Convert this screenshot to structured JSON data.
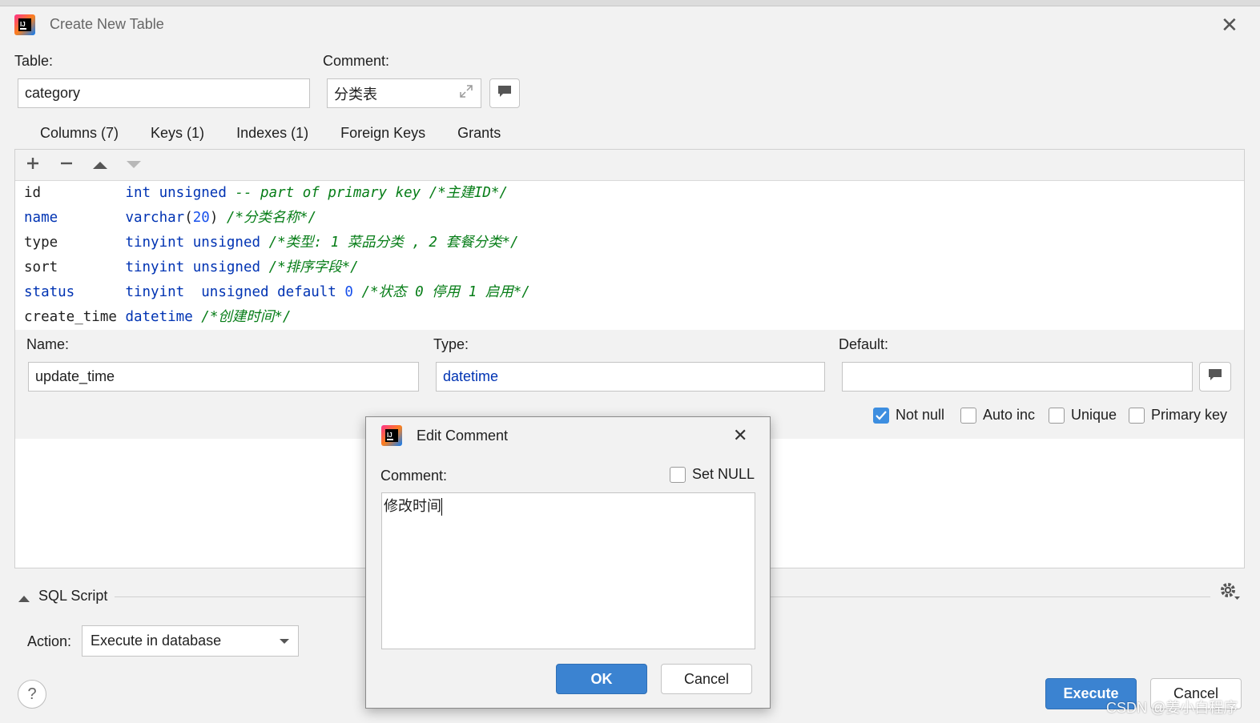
{
  "window": {
    "title": "Create New Table"
  },
  "table": {
    "label": "Table:",
    "value": "category"
  },
  "comment": {
    "label": "Comment:",
    "value": "分类表"
  },
  "tabs": [
    {
      "label": "Columns (7)"
    },
    {
      "label": "Keys (1)"
    },
    {
      "label": "Indexes (1)"
    },
    {
      "label": "Foreign Keys"
    },
    {
      "label": "Grants"
    }
  ],
  "columns": [
    {
      "name": "id",
      "def": "int unsigned -- part of primary key /*主建ID*/"
    },
    {
      "name": "name",
      "def": "varchar(20) /*分类名称*/"
    },
    {
      "name": "type",
      "def": "tinyint unsigned /*类型: 1 菜品分类 , 2 套餐分类*/"
    },
    {
      "name": "sort",
      "def": "tinyint unsigned /*排序字段*/"
    },
    {
      "name": "status",
      "def": "tinyint  unsigned default 0 /*状态 0 停用 1 启用*/"
    },
    {
      "name": "create_time",
      "def": "datetime /*创建时间*/"
    }
  ],
  "props": {
    "name_label": "Name:",
    "name_value": "update_time",
    "type_label": "Type:",
    "type_value": "datetime",
    "default_label": "Default:",
    "default_value": "",
    "not_null": "Not null",
    "auto_inc": "Auto inc",
    "unique": "Unique",
    "primary_key": "Primary key"
  },
  "sql_script": {
    "label": "SQL Script"
  },
  "action": {
    "label": "Action:",
    "value": "Execute in database"
  },
  "buttons": {
    "execute": "Execute",
    "cancel": "Cancel",
    "help": "?"
  },
  "dialog": {
    "title": "Edit Comment",
    "comment_label": "Comment:",
    "set_null": "Set NULL",
    "text": "修改时间",
    "ok": "OK",
    "cancel": "Cancel"
  },
  "watermark": "CSDN @姜小白程序",
  "colors": {
    "accent": "#3b83d1",
    "keyword": "#0033b3",
    "comment": "#067d17",
    "number": "#1750eb"
  }
}
